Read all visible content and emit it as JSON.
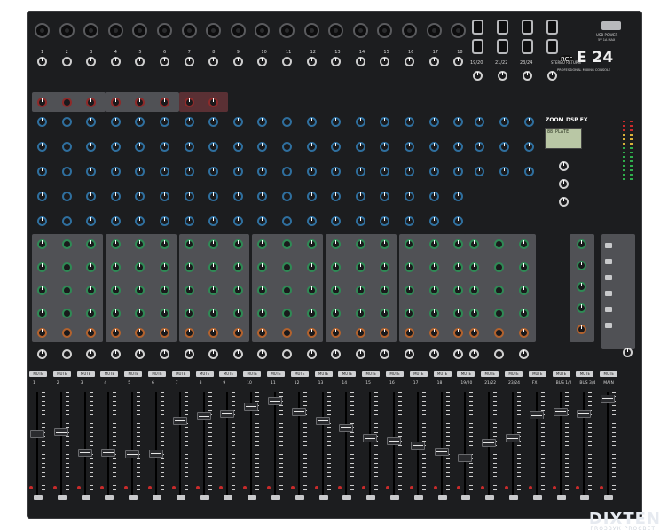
{
  "brand": {
    "logo_text": "RCF",
    "model": "E 24",
    "subtitle": "PROFESSIONAL MIXING CONSOLE"
  },
  "usb": {
    "label": "USB POWER",
    "sublabel": "5V 1A MAX"
  },
  "dsp": {
    "brand": "ZOOM",
    "label": "DSP FX",
    "display_text": "88 PLATE"
  },
  "channels": [
    "1",
    "2",
    "3",
    "4",
    "5",
    "6",
    "7",
    "8",
    "9",
    "10",
    "11",
    "12",
    "13",
    "14",
    "15",
    "16",
    "17",
    "18"
  ],
  "stereo_inputs": [
    "19/20",
    "21/22",
    "23/24"
  ],
  "stereo_return_label": "STEREO RETURN",
  "strip_labels": [
    "1",
    "2",
    "3",
    "4",
    "5",
    "6",
    "7",
    "8",
    "9",
    "10",
    "11",
    "12",
    "13",
    "14",
    "15",
    "16",
    "17",
    "18",
    "19/20",
    "21/22",
    "23/24",
    "FX",
    "BUS 1/2",
    "BUS 3/4",
    "MAIN"
  ],
  "mute_label": "MUTE",
  "watermark": {
    "text": "DIXTEN",
    "sub": "PROЗВУК PROСВЕТ"
  },
  "colors": {
    "panel": "#1c1d1f",
    "knob_blue": "#2f6f9e",
    "knob_green": "#2f8a55",
    "knob_orange": "#b3622e",
    "knob_red": "#8e2a2a",
    "mute_button": "#cfd0d2",
    "led_red": "#c92b2b"
  }
}
